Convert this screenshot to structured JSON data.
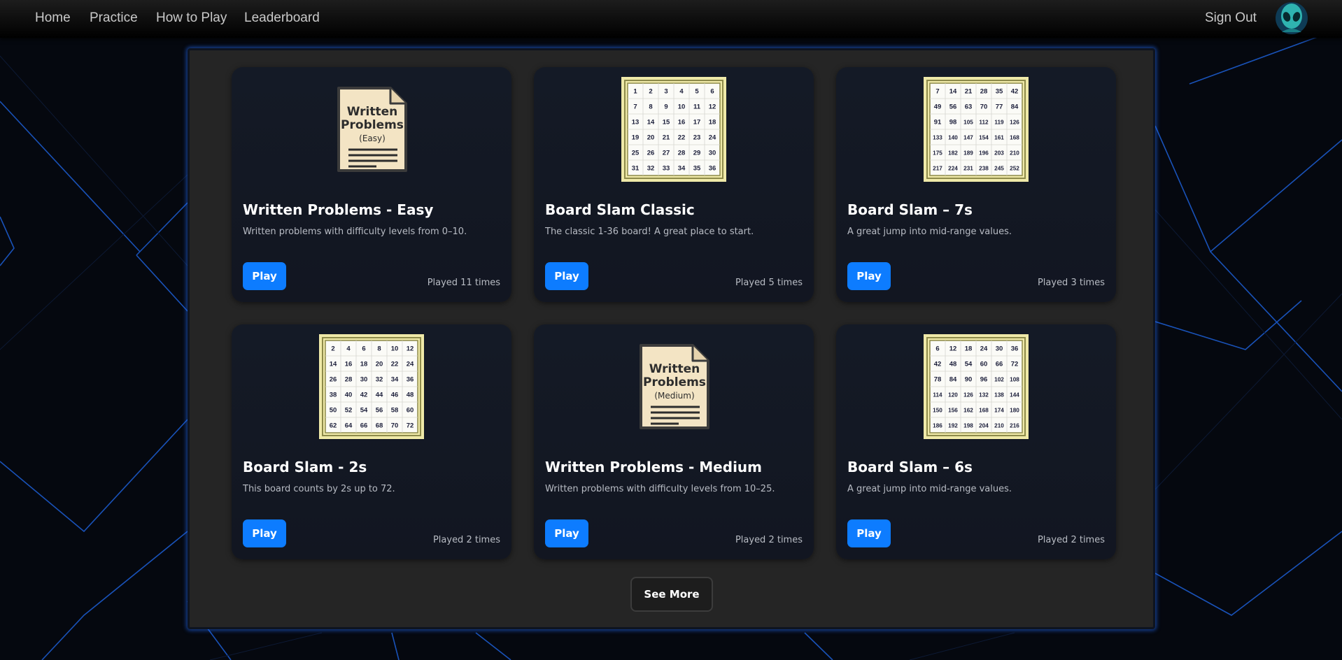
{
  "nav": {
    "links": [
      "Home",
      "Practice",
      "How to Play",
      "Leaderboard"
    ],
    "sign_out": "Sign Out"
  },
  "cards": [
    {
      "title": "Written Problems - Easy",
      "description": "Written problems with difficulty levels from 0–10.",
      "play_label": "Play",
      "played": "Played 11 times",
      "image": {
        "kind": "document",
        "lines": [
          "Written",
          "Problems",
          "(Easy)"
        ]
      }
    },
    {
      "title": "Board Slam Classic",
      "description": "The classic 1-36 board! A great place to start.",
      "play_label": "Play",
      "played": "Played 5 times",
      "image": {
        "kind": "board",
        "numbers": [
          1,
          2,
          3,
          4,
          5,
          6,
          7,
          8,
          9,
          10,
          11,
          12,
          13,
          14,
          15,
          16,
          17,
          18,
          19,
          20,
          21,
          22,
          23,
          24,
          25,
          26,
          27,
          28,
          29,
          30,
          31,
          32,
          33,
          34,
          35,
          36
        ]
      }
    },
    {
      "title": "Board Slam – 7s",
      "description": "A great jump into mid-range values.",
      "play_label": "Play",
      "played": "Played 3 times",
      "image": {
        "kind": "board",
        "numbers": [
          7,
          14,
          21,
          28,
          35,
          42,
          49,
          56,
          63,
          70,
          77,
          84,
          91,
          98,
          105,
          112,
          119,
          126,
          133,
          140,
          147,
          154,
          161,
          168,
          175,
          182,
          189,
          196,
          203,
          210,
          217,
          224,
          231,
          238,
          245,
          252
        ]
      }
    },
    {
      "title": "Board Slam - 2s",
      "description": "This board counts by 2s up to 72.",
      "play_label": "Play",
      "played": "Played 2 times",
      "image": {
        "kind": "board",
        "numbers": [
          2,
          4,
          6,
          8,
          10,
          12,
          14,
          16,
          18,
          20,
          22,
          24,
          26,
          28,
          30,
          32,
          34,
          36,
          38,
          40,
          42,
          44,
          46,
          48,
          50,
          52,
          54,
          56,
          58,
          60,
          62,
          64,
          66,
          68,
          70,
          72
        ]
      }
    },
    {
      "title": "Written Problems - Medium",
      "description": "Written problems with difficulty levels from 10–25.",
      "play_label": "Play",
      "played": "Played 2 times",
      "image": {
        "kind": "document",
        "lines": [
          "Written",
          "Problems",
          "(Medium)"
        ]
      }
    },
    {
      "title": "Board Slam – 6s",
      "description": "A great jump into mid-range values.",
      "play_label": "Play",
      "played": "Played 2 times",
      "image": {
        "kind": "board",
        "numbers": [
          6,
          12,
          18,
          24,
          30,
          36,
          42,
          48,
          54,
          60,
          66,
          72,
          78,
          84,
          90,
          96,
          102,
          108,
          114,
          120,
          126,
          132,
          138,
          144,
          150,
          156,
          162,
          168,
          174,
          180,
          186,
          192,
          198,
          204,
          210,
          216
        ]
      }
    }
  ],
  "see_more": "See More",
  "colors": {
    "accent": "#0d7cff",
    "panel": "#252525",
    "card": "#141a26",
    "glow": "#1f6bff",
    "board_frame": "#c9c37a",
    "document": "#f3e4c4"
  },
  "icons": {
    "avatar": "alien-avatar-icon"
  }
}
